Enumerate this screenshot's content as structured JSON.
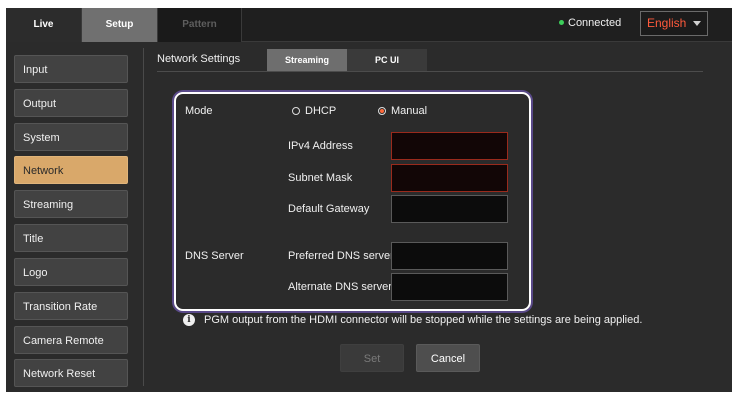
{
  "topbar": {
    "tabs": [
      {
        "label": "Live"
      },
      {
        "label": "Setup"
      },
      {
        "label": "Pattern"
      }
    ],
    "status": "Connected",
    "language": "English"
  },
  "sidebar": {
    "items": [
      {
        "label": "Input"
      },
      {
        "label": "Output"
      },
      {
        "label": "System"
      },
      {
        "label": "Network"
      },
      {
        "label": "Streaming"
      },
      {
        "label": "Title"
      },
      {
        "label": "Logo"
      },
      {
        "label": "Transition Rate"
      },
      {
        "label": "Camera Remote"
      },
      {
        "label": "Network Reset"
      }
    ],
    "active": "Network"
  },
  "main": {
    "title": "Network Settings",
    "subtabs": [
      {
        "label": "Streaming"
      },
      {
        "label": "PC UI"
      }
    ],
    "form": {
      "mode_label": "Mode",
      "mode_options": [
        {
          "label": "DHCP",
          "selected": false
        },
        {
          "label": "Manual",
          "selected": true
        }
      ],
      "dns_label": "DNS Server",
      "fields": [
        {
          "label": "IPv4 Address",
          "value": ""
        },
        {
          "label": "Subnet Mask",
          "value": ""
        },
        {
          "label": "Default Gateway",
          "value": ""
        },
        {
          "label": "Preferred DNS server",
          "value": ""
        },
        {
          "label": "Alternate DNS server",
          "value": ""
        }
      ]
    },
    "info": {
      "icon": "info-icon",
      "icon_glyph": "i",
      "text": "PGM output from the HDMI connector will be stopped while the settings are being applied."
    },
    "buttons": {
      "set": "Set",
      "cancel": "Cancel"
    }
  },
  "colors": {
    "accent": "#ff5a3c",
    "active_item": "#d9a86a",
    "connected": "#3ccf5a"
  }
}
